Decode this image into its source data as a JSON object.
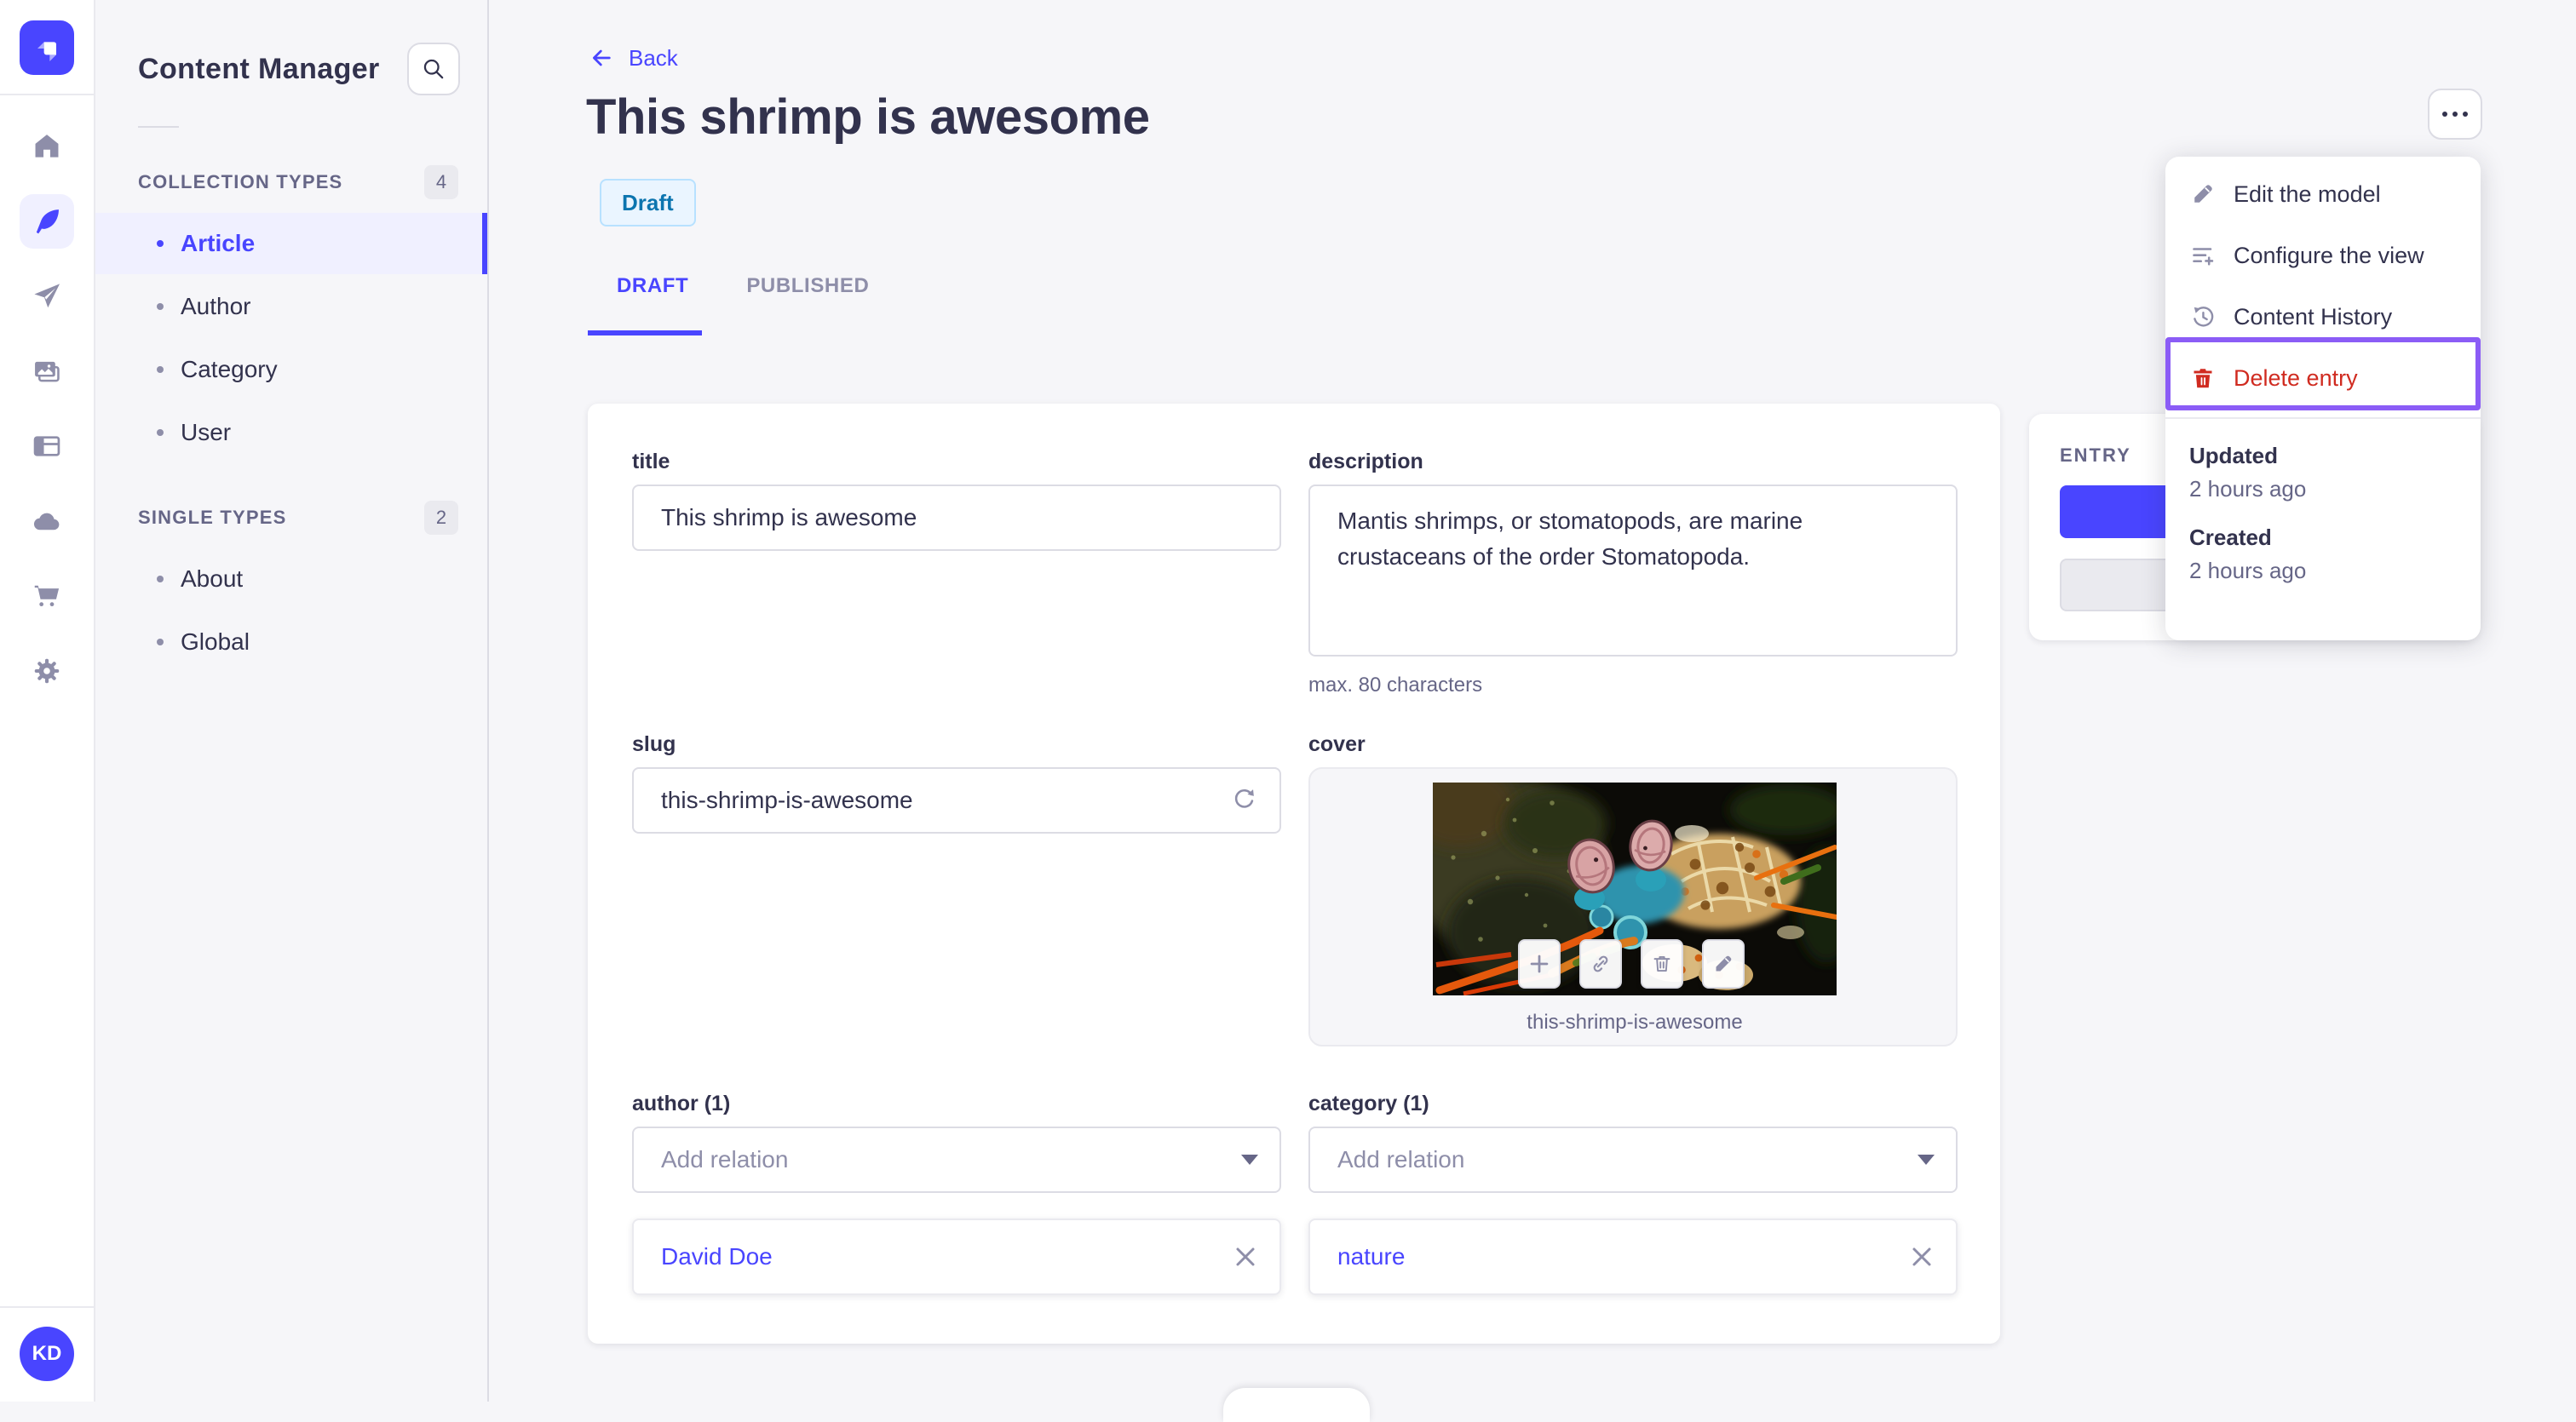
{
  "colors": {
    "accent": "#4945ff",
    "accent_light": "#f0f0ff",
    "danger": "#d02b20",
    "highlight_ring": "#8b5cf6",
    "draft_badge_bg": "#eaf5ff",
    "draft_badge_border": "#b8e1ff",
    "draft_badge_text": "#0c75af"
  },
  "rail": {
    "icons": [
      "home-icon",
      "content-manager-feather-icon",
      "paper-plane-icon",
      "media-library-icon",
      "layout-icon",
      "cloud-icon",
      "cart-icon",
      "gear-icon"
    ],
    "avatar_initials": "KD"
  },
  "sidebar": {
    "title": "Content Manager",
    "sections": [
      {
        "label": "COLLECTION TYPES",
        "count": "4",
        "items": [
          {
            "label": "Article",
            "active": true
          },
          {
            "label": "Author"
          },
          {
            "label": "Category"
          },
          {
            "label": "User"
          }
        ]
      },
      {
        "label": "SINGLE TYPES",
        "count": "2",
        "items": [
          {
            "label": "About"
          },
          {
            "label": "Global"
          }
        ]
      }
    ]
  },
  "header": {
    "back_label": "Back",
    "title": "This shrimp is awesome",
    "status": "Draft",
    "tabs": [
      "DRAFT",
      "PUBLISHED"
    ]
  },
  "form": {
    "title": {
      "label": "title",
      "value": "This shrimp is awesome"
    },
    "description": {
      "label": "description",
      "value": "Mantis shrimps, or stomatopods, are marine crustaceans of the order Stomatopoda.",
      "hint": "max. 80 characters"
    },
    "slug": {
      "label": "slug",
      "value": "this-shrimp-is-awesome"
    },
    "cover": {
      "label": "cover",
      "caption": "this-shrimp-is-awesome",
      "actions": [
        "add-icon",
        "link-icon",
        "trash-icon",
        "pencil-icon"
      ]
    },
    "author": {
      "label": "author (1)",
      "placeholder": "Add relation",
      "relations": [
        {
          "label": "David Doe"
        }
      ]
    },
    "category": {
      "label": "category (1)",
      "placeholder": "Add relation",
      "relations": [
        {
          "label": "nature"
        }
      ]
    }
  },
  "entry_panel": {
    "title": "ENTRY"
  },
  "menu": {
    "items": [
      {
        "label": "Edit the model",
        "icon": "pencil-icon"
      },
      {
        "label": "Configure the view",
        "icon": "configure-list-icon"
      },
      {
        "label": "Content History",
        "icon": "history-icon"
      },
      {
        "label": "Delete entry",
        "icon": "trash-icon",
        "danger": true,
        "highlighted": true
      }
    ],
    "meta": [
      {
        "label": "Updated",
        "value": "2 hours ago"
      },
      {
        "label": "Created",
        "value": "2 hours ago"
      }
    ]
  }
}
